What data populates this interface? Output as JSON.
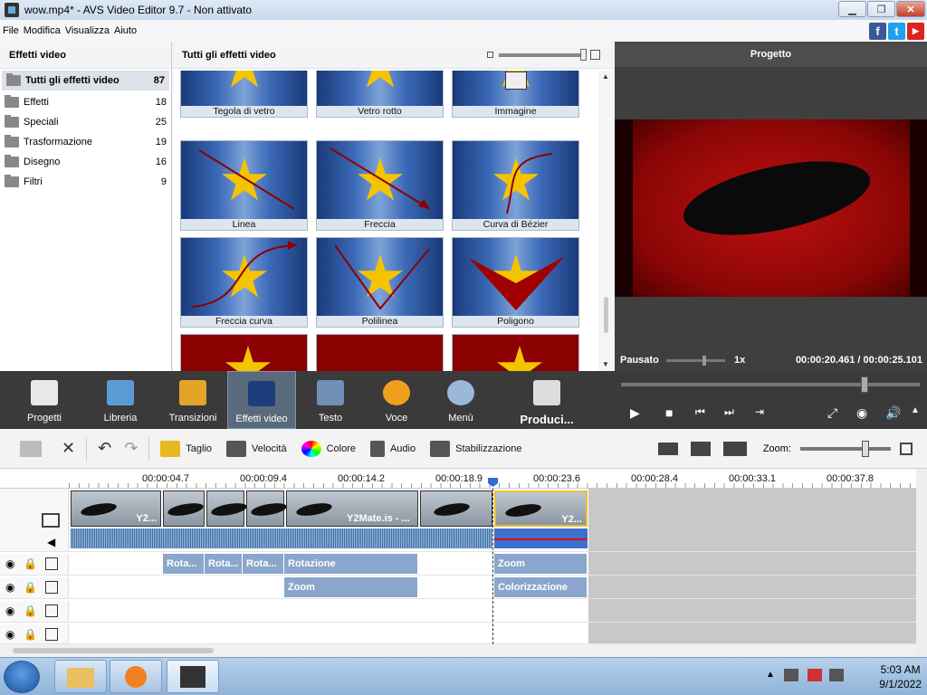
{
  "window": {
    "title": "wow.mp4* - AVS Video Editor 9.7 - Non attivato",
    "minimize": "▁",
    "restore": "❐",
    "close": "✕"
  },
  "menu": [
    "File",
    "Modifica",
    "Visualizza",
    "Aiuto"
  ],
  "social": {
    "facebook": "f",
    "twitter": "t",
    "youtube": "▶"
  },
  "left": {
    "title": "Effetti video",
    "categories": [
      {
        "name": "Tutti gli effetti video",
        "count": "87"
      },
      {
        "name": "Effetti",
        "count": "18"
      },
      {
        "name": "Speciali",
        "count": "25"
      },
      {
        "name": "Trasformazione",
        "count": "19"
      },
      {
        "name": "Disegno",
        "count": "16"
      },
      {
        "name": "Filtri",
        "count": "9"
      }
    ]
  },
  "effects": {
    "title": "Tutti gli effetti video",
    "tiles": [
      "Tegola di vetro",
      "Vetro rotto",
      "Immagine",
      "Linea",
      "Freccia",
      "Curva di Bézier",
      "Freccia curva",
      "Polilinea",
      "Poligono"
    ]
  },
  "preview": {
    "title": "Progetto",
    "status": "Pausato",
    "speed": "1x",
    "time": "00:00:20.461  /  00:00:25.101"
  },
  "toolbar": {
    "items": [
      "Progetti",
      "Libreria",
      "Transizioni",
      "Effetti video",
      "Testo",
      "Voce",
      "Menù",
      "Produci..."
    ]
  },
  "edit": {
    "taglio": "Taglio",
    "velocita": "Velocità",
    "colore": "Colore",
    "audio": "Audio",
    "stabilizzazione": "Stabilizzazione",
    "zoom": "Zoom:"
  },
  "ruler": [
    "00:00:04.7",
    "00:00:09.4",
    "00:00:14.2",
    "00:00:18.9",
    "00:00:23.6",
    "00:00:28.4",
    "00:00:33.1",
    "00:00:37.8"
  ],
  "clips": {
    "c1": "Y2...",
    "c2": "Y2Mate.is - ...",
    "c3": "Y2..."
  },
  "fx1": [
    "Rota...",
    "Rota...",
    "Rota...",
    "Rotazione",
    "Zoom"
  ],
  "fx2": [
    "Zoom",
    "Colorizzazione"
  ],
  "tray": {
    "time": "5:03 AM",
    "date": "9/1/2022"
  },
  "colors": {
    "accent": "#2f6dd0",
    "clip": "#8aa6cc"
  }
}
